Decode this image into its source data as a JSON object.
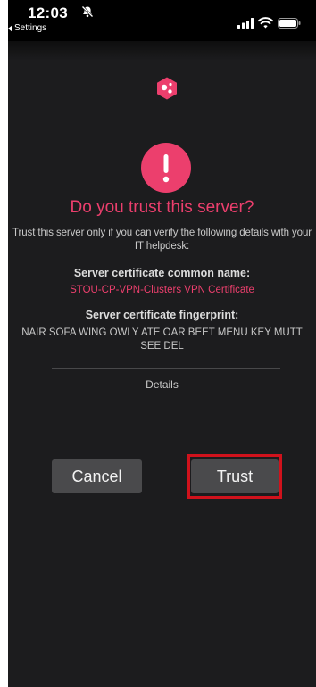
{
  "status_bar": {
    "time": "12:03",
    "back_label": "Settings"
  },
  "dialog": {
    "title": "Do you trust this server?",
    "intro": "Trust this server only if you can verify the following details with your IT helpdesk:",
    "common_name_label": "Server certificate common name:",
    "common_name_value": "STOU-CP-VPN-Clusters VPN Certificate",
    "fingerprint_label": "Server certificate fingerprint:",
    "fingerprint_value": "NAIR SOFA WING OWLY ATE OAR BEET MENU KEY MUTT SEE DEL",
    "details_label": "Details"
  },
  "buttons": {
    "cancel_label": "Cancel",
    "trust_label": "Trust"
  },
  "colors": {
    "accent": "#ec3f6d",
    "background": "#1c1c1e",
    "button": "#4a4a4c",
    "highlight": "#d0121c"
  },
  "icons": {
    "status": [
      "bell-slash-icon",
      "signal-bars-icon",
      "wifi-icon",
      "battery-icon"
    ],
    "app": "app-logo-icon",
    "alert": "exclamation-icon"
  }
}
